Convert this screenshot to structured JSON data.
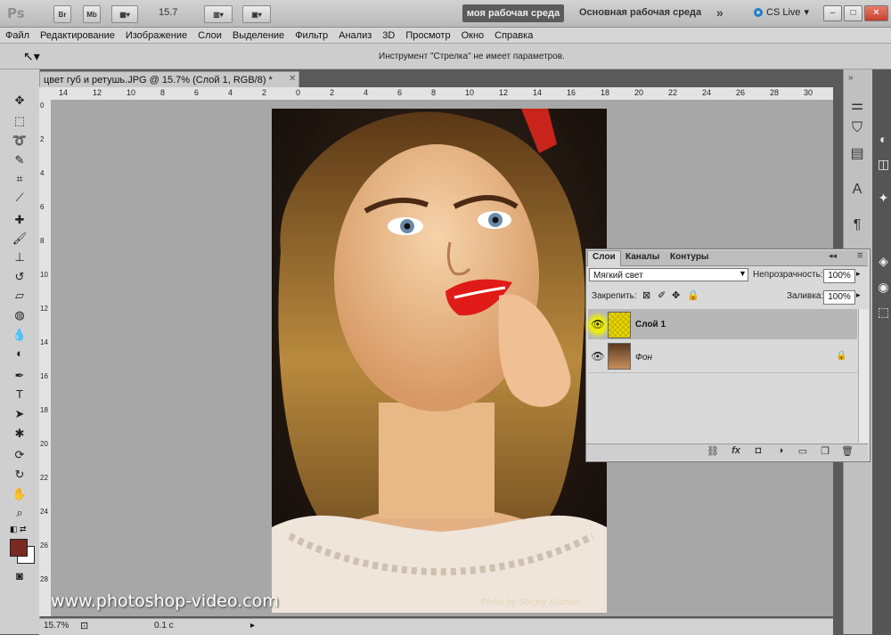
{
  "appbar": {
    "logo": "Ps",
    "bridge": "Br",
    "minibridge": "Mb",
    "zoom": "15.7",
    "workspace_active": "моя рабочая среда",
    "workspace_main": "Основная рабочая среда",
    "more": "»",
    "cslive": "CS Live"
  },
  "menu": [
    "Файл",
    "Редактирование",
    "Изображение",
    "Слои",
    "Выделение",
    "Фильтр",
    "Анализ",
    "3D",
    "Просмотр",
    "Окно",
    "Справка"
  ],
  "options_bar": {
    "text": "Инструмент \"Стрелка\" не имеет параметров."
  },
  "document": {
    "tab_title": "цвет губ и ретушь.JPG @ 15.7% (Слой 1, RGB/8) *",
    "ruler_top": [
      "14",
      "12",
      "10",
      "8",
      "6",
      "4",
      "2",
      "0",
      "2",
      "4",
      "6",
      "8",
      "10",
      "12",
      "14",
      "16",
      "18",
      "20",
      "22",
      "24",
      "26",
      "28",
      "30"
    ],
    "ruler_left": [
      "0",
      "2",
      "4",
      "6",
      "8",
      "10",
      "12",
      "14",
      "16",
      "18",
      "20",
      "22",
      "24",
      "26",
      "28"
    ],
    "photo_credit": "Photo by Sergey Kuzmin",
    "watermark": "www.photoshop-video.com",
    "status_zoom": "15.7%",
    "status_value": "0.1 c"
  },
  "layers_panel": {
    "tabs": [
      "Слои",
      "Каналы",
      "Контуры"
    ],
    "blend_mode": "Мягкий свет",
    "opacity_label": "Непрозрачность:",
    "opacity_value": "100%",
    "lock_label": "Закрепить:",
    "fill_label": "Заливка:",
    "fill_value": "100%",
    "layers": [
      {
        "name": "Слой 1",
        "selected": true
      },
      {
        "name": "Фон",
        "selected": false
      }
    ]
  },
  "colors": {
    "foreground": "#7b2a22",
    "background": "#ffffff",
    "workspace_active_bg": "#5b5b5b",
    "canvas_bg": "#a7a7a7"
  }
}
